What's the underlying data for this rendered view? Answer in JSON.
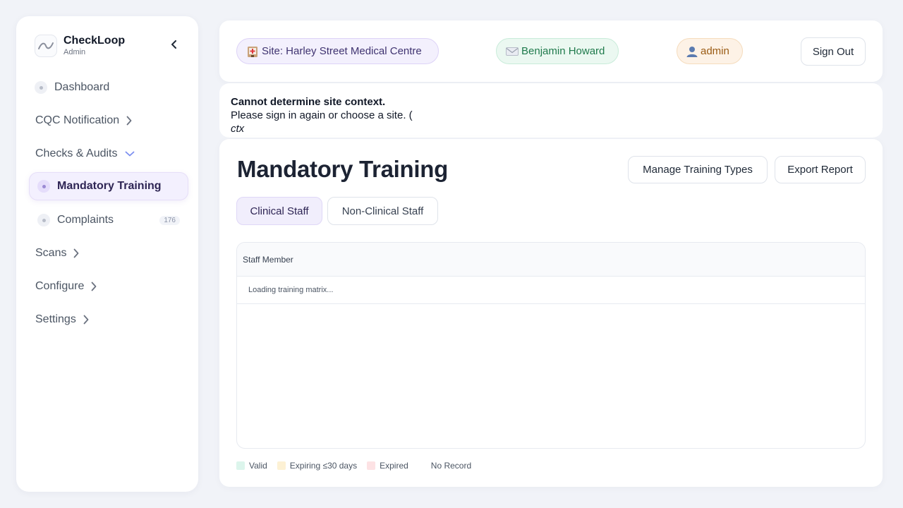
{
  "brand": {
    "name": "CheckLoop",
    "role": "Admin"
  },
  "sidebar": {
    "items": [
      {
        "label": "Dashboard"
      },
      {
        "label": "CQC Notification"
      },
      {
        "label": "Checks & Audits"
      },
      {
        "label": "Mandatory Training"
      },
      {
        "label": "Complaints",
        "count": "176"
      },
      {
        "label": "Scans"
      },
      {
        "label": "Configure"
      },
      {
        "label": "Settings"
      }
    ]
  },
  "topbar": {
    "site_label": "Site: Harley Street Medical Centre",
    "user_label": "Benjamin Howard",
    "role_label": "admin",
    "sign_out": "Sign Out"
  },
  "error": {
    "title": "Cannot determine site context.",
    "message": "Please sign in again or choose a site. (",
    "context": "ctx"
  },
  "main": {
    "title": "Mandatory Training",
    "manage_button": "Manage Training Types",
    "export_button": "Export Report",
    "tabs": [
      {
        "label": "Clinical Staff",
        "active": true
      },
      {
        "label": "Non-Clinical Staff",
        "active": false
      }
    ],
    "table": {
      "header": "Staff Member",
      "loading": "Loading training matrix..."
    },
    "legend": [
      {
        "label": "Valid",
        "color": "#dcf5ec"
      },
      {
        "label": "Expiring ≤30 days",
        "color": "#fdf1d4"
      },
      {
        "label": "Expired",
        "color": "#fde2e4"
      },
      {
        "label": "No Record",
        "color": "#ffffff"
      }
    ]
  },
  "colors": {
    "accent": "#7c5cd6",
    "active_nav_bg": "#f3f0fe",
    "background": "#f1f3f8"
  }
}
